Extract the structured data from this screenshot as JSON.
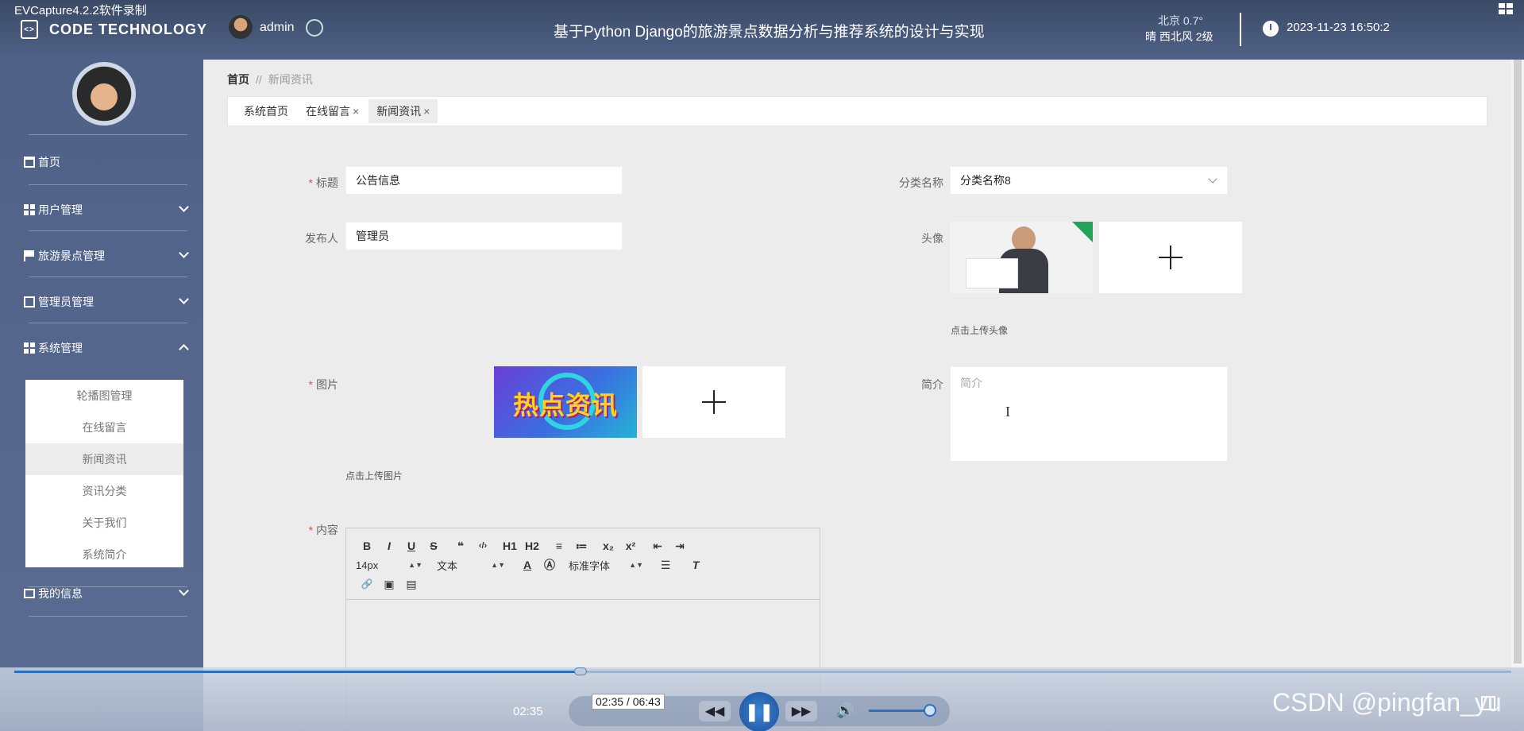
{
  "capture_title": "EVCapture4.2.2软件录制",
  "header": {
    "logo_text": "CODE TECHNOLOGY",
    "username": "admin",
    "system_title": "基于Python Django的旅游景点数据分析与推荐系统的设计与实现",
    "weather": {
      "line1": "北京  0.7°",
      "line2": "晴  西北风  2级"
    },
    "datetime": "2023-11-23 16:50:2"
  },
  "sidebar": {
    "items": [
      {
        "label": "首页"
      },
      {
        "label": "用户管理"
      },
      {
        "label": "旅游景点管理"
      },
      {
        "label": "管理员管理"
      },
      {
        "label": "系统管理"
      },
      {
        "label": "我的信息"
      }
    ],
    "submenu": [
      {
        "label": "轮播图管理"
      },
      {
        "label": "在线留言"
      },
      {
        "label": "新闻资讯",
        "active": true
      },
      {
        "label": "资讯分类"
      },
      {
        "label": "关于我们"
      },
      {
        "label": "系统简介"
      }
    ]
  },
  "breadcrumb": {
    "home": "首页",
    "separator": "//",
    "current": "新闻资讯"
  },
  "tabs": [
    {
      "label": "系统首页",
      "closable": false
    },
    {
      "label": "在线留言",
      "closable": true
    },
    {
      "label": "新闻资讯",
      "closable": true,
      "active": true
    }
  ],
  "form": {
    "title_label": "标题",
    "title_value": "公告信息",
    "category_label": "分类名称",
    "category_value": "分类名称8",
    "publisher_label": "发布人",
    "publisher_value": "管理员",
    "avatar_label": "头像",
    "avatar_hint": "点击上传头像",
    "image_label": "图片",
    "image_text": "热点资讯",
    "image_hint": "点击上传图片",
    "intro_label": "简介",
    "intro_placeholder": "简介",
    "content_label": "内容",
    "close_mark": "×",
    "required_mark": "*"
  },
  "editor": {
    "row1": [
      "B",
      "I",
      "U",
      "S",
      "❝",
      "‹/›",
      "H1",
      "H2",
      "≡",
      "≔",
      "x₂",
      "x²",
      "⇤",
      "⇥"
    ],
    "font_size": "14px",
    "text_style": "文本",
    "font_family": "标准字体",
    "row3": [
      "🔗",
      "▣",
      "▤"
    ]
  },
  "player": {
    "current_time": "02:35",
    "tooltip": "02:35 / 06:43",
    "progress": 0.378,
    "volume": 0.85
  },
  "watermark": "CSDN @pingfan_yu"
}
